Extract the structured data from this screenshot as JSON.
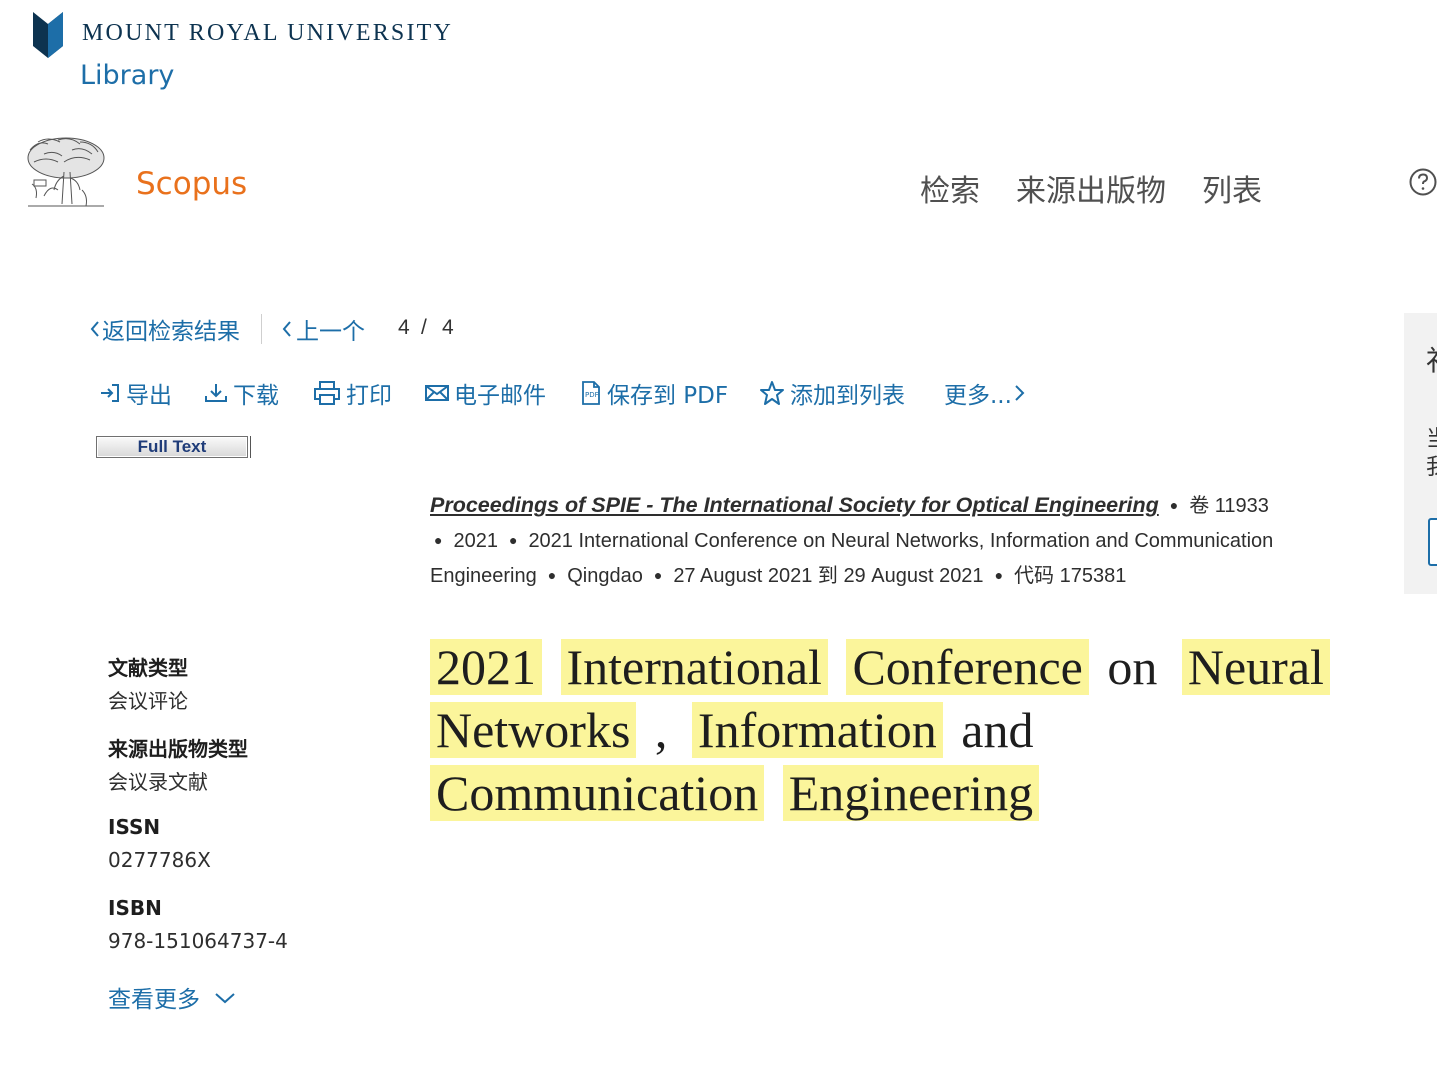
{
  "library": {
    "university": "MOUNT ROYAL UNIVERSITY",
    "label": "Library"
  },
  "scopus": {
    "brand": "Scopus",
    "nav": [
      "检索",
      "来源出版物",
      "列表"
    ]
  },
  "colors": {
    "accent": "#1d6ea8",
    "brand": "#e9711c",
    "highlight": "#fbf59b",
    "mru_navy": "#0d3350"
  },
  "icons": [
    "mru-shield-icon",
    "elsevier-tree-logo",
    "help-icon",
    "chevron-left-icon",
    "export-icon",
    "download-icon",
    "print-icon",
    "email-icon",
    "pdf-icon",
    "star-icon",
    "chevron-right-icon",
    "chevron-down-icon"
  ],
  "result_nav": {
    "back": "返回检索结果",
    "prev": "上一个",
    "current": "4",
    "sep": "/",
    "total": "4"
  },
  "toolbar": {
    "export": "导出",
    "download": "下载",
    "print": "打印",
    "email": "电子邮件",
    "save_pdf": "保存到 PDF",
    "add_list": "添加到列表",
    "more": "更多..."
  },
  "full_text": "Full Text",
  "source": {
    "journal": "Proceedings of SPIE - The International Society for Optical Engineering",
    "volume": "卷 11933",
    "year": "2021",
    "conference": "2021 International Conference on Neural Networks, Information and Communication Engineering",
    "location": "Qingdao",
    "dates": "27 August 2021 到 29 August 2021",
    "code": "代码 175381"
  },
  "title_words": [
    {
      "w": "2021",
      "h": true
    },
    {
      "w": "International",
      "h": true
    },
    {
      "w": "Conference",
      "h": true
    },
    {
      "w": "on",
      "h": false
    },
    {
      "w": "Neural",
      "h": true
    },
    {
      "w": "Networks",
      "h": true
    },
    {
      "w": ",",
      "h": false
    },
    {
      "w": "Information",
      "h": true
    },
    {
      "w": "and",
      "h": false
    },
    {
      "w": "Communication",
      "h": true
    },
    {
      "w": "Engineering",
      "h": true
    }
  ],
  "metadata": [
    {
      "label": "文献类型",
      "value": "会议评论"
    },
    {
      "label": "来源出版物类型",
      "value": "会议录文献"
    },
    {
      "label": "ISSN",
      "value": "0277786X"
    },
    {
      "label": "ISBN",
      "value": "978-151064737-4"
    }
  ],
  "show_more": "查看更多",
  "side_panel": {
    "t1": "补",
    "t2": "当我"
  }
}
